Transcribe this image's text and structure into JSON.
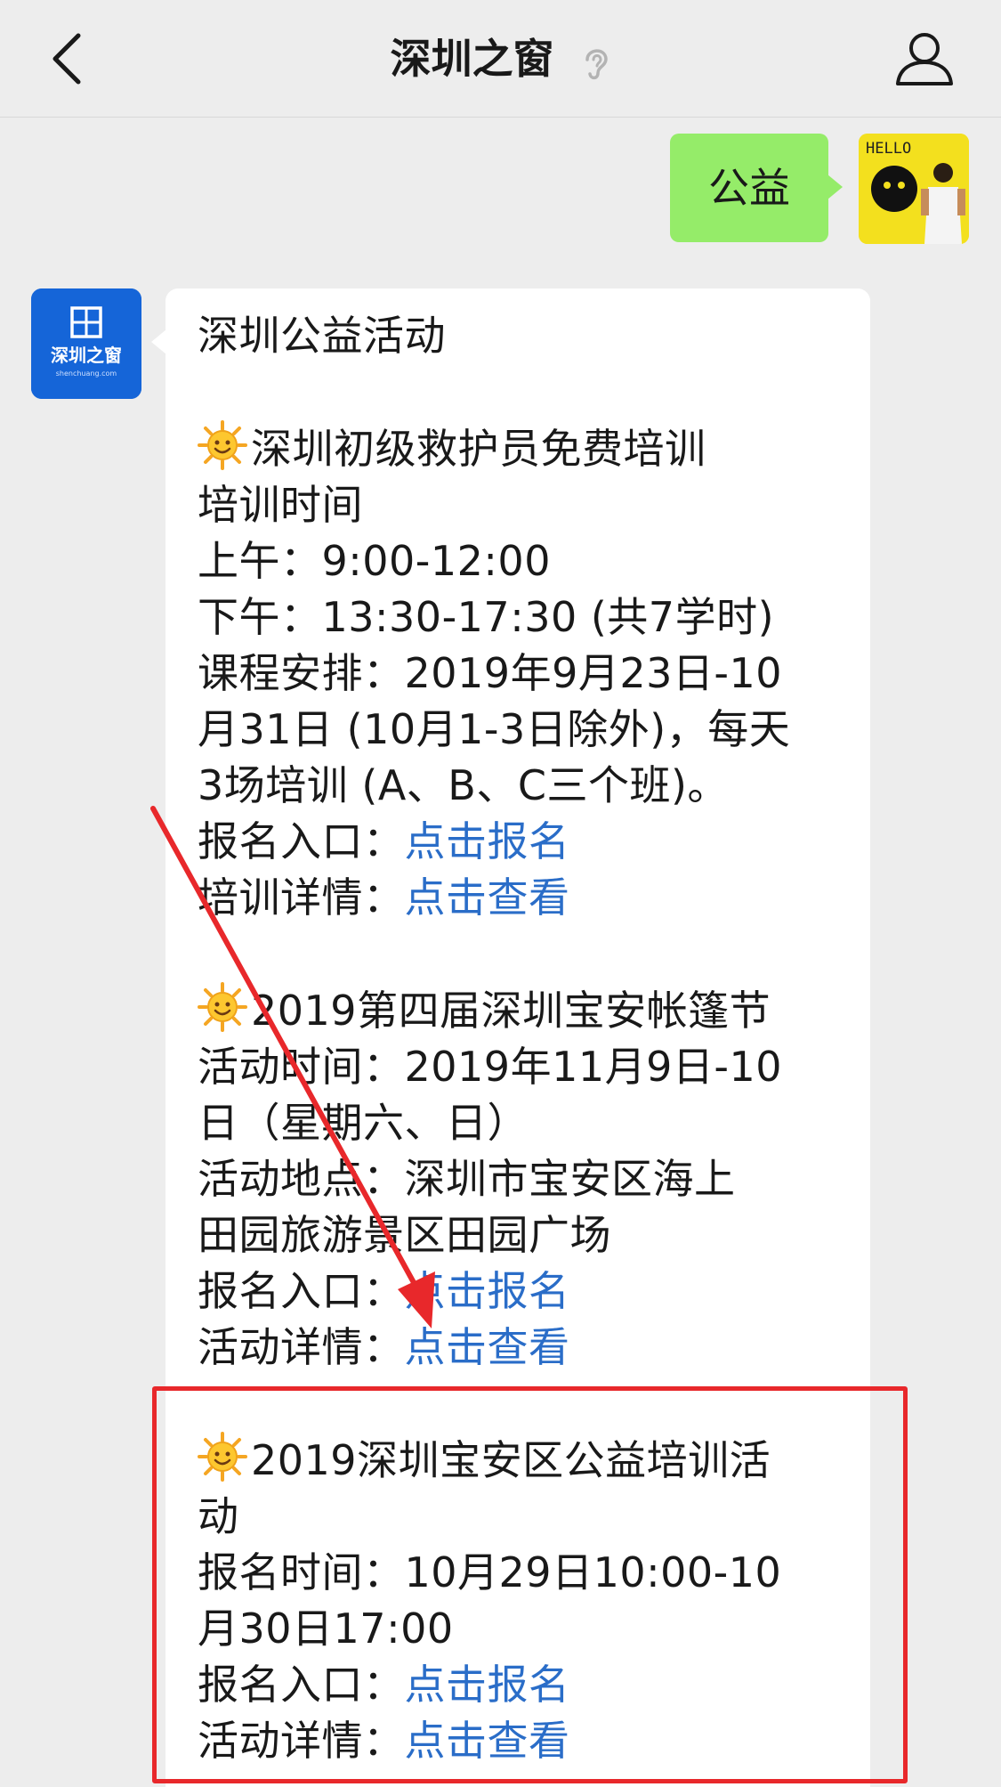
{
  "header": {
    "title": "深圳之窗",
    "back_icon": "chevron-left-icon",
    "ear_icon": "ear-icon",
    "profile_icon": "person-icon"
  },
  "sent_message": {
    "text": "公益",
    "avatar_label": "HELLO"
  },
  "received_message": {
    "avatar_label": "深圳之窗",
    "avatar_sublabel": "shenchuang.com",
    "heading": "深圳公益活动",
    "sections": [
      {
        "title": "深圳初级救护员免费培训",
        "lines": [
          "培训时间",
          "上午：9:00-12:00",
          "下午：13:30-17:30 (共7学时)",
          "课程安排：2019年9月23日-10",
          "月31日 (10月1-3日除外)，每天",
          "3场培训 (A、B、C三个班)。"
        ],
        "signup_label": "报名入口：",
        "signup_link": "点击报名",
        "detail_label": "培训详情：",
        "detail_link": "点击查看"
      },
      {
        "title": "2019第四届深圳宝安帐篷节",
        "lines": [
          "活动时间：2019年11月9日-10",
          "日（星期六、日）",
          "活动地点：深圳市宝安区海上",
          "田园旅游景区田园广场"
        ],
        "signup_label": "报名入口：",
        "signup_link": "点击报名",
        "detail_label": "活动详情：",
        "detail_link": "点击查看"
      },
      {
        "title": "2019深圳宝安区公益培训活",
        "lines": [
          "动",
          "报名时间：10月29日10:00-10",
          "月30日17:00"
        ],
        "signup_label": "报名入口：",
        "signup_link": "点击报名",
        "detail_label": "活动详情：",
        "detail_link": "点击查看"
      }
    ]
  },
  "colors": {
    "background": "#ededed",
    "sent_bubble": "#95ec69",
    "link": "#2a6dc8",
    "annotation": "#e8282b"
  }
}
